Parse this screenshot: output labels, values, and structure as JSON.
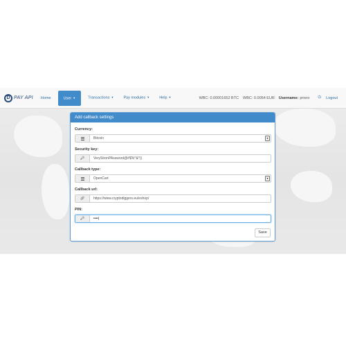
{
  "brand": {
    "logo_letter": "D",
    "name": "PAY API"
  },
  "nav": {
    "home": "Home",
    "user": "User",
    "transactions": "Transactions",
    "pay_modules": "Pay modules",
    "help": "Help"
  },
  "status": {
    "balance_btc": "WBC: 0.00001652 BTC",
    "balance_eur": "WBC: 0.0054 EUR",
    "username_label": "Username:",
    "username": "prono",
    "logout": "Logout"
  },
  "panel": {
    "title": "Add callback settings",
    "currency": {
      "label": "Currency:",
      "value": "Bitcoin"
    },
    "security_key": {
      "label": "Security key:",
      "value": "VeryStronPAssword@#$%^&*()"
    },
    "callback_type": {
      "label": "Callback type:",
      "value": "OpenCart"
    },
    "callback_url": {
      "label": "Callback url:",
      "value": "https://www.cryptodiggers.eu/eshop/"
    },
    "pin": {
      "label": "PIN:",
      "value": "••••|"
    },
    "save": "Save"
  },
  "colors": {
    "accent": "#428bca",
    "navbar_bg": "#f8f8f8"
  }
}
